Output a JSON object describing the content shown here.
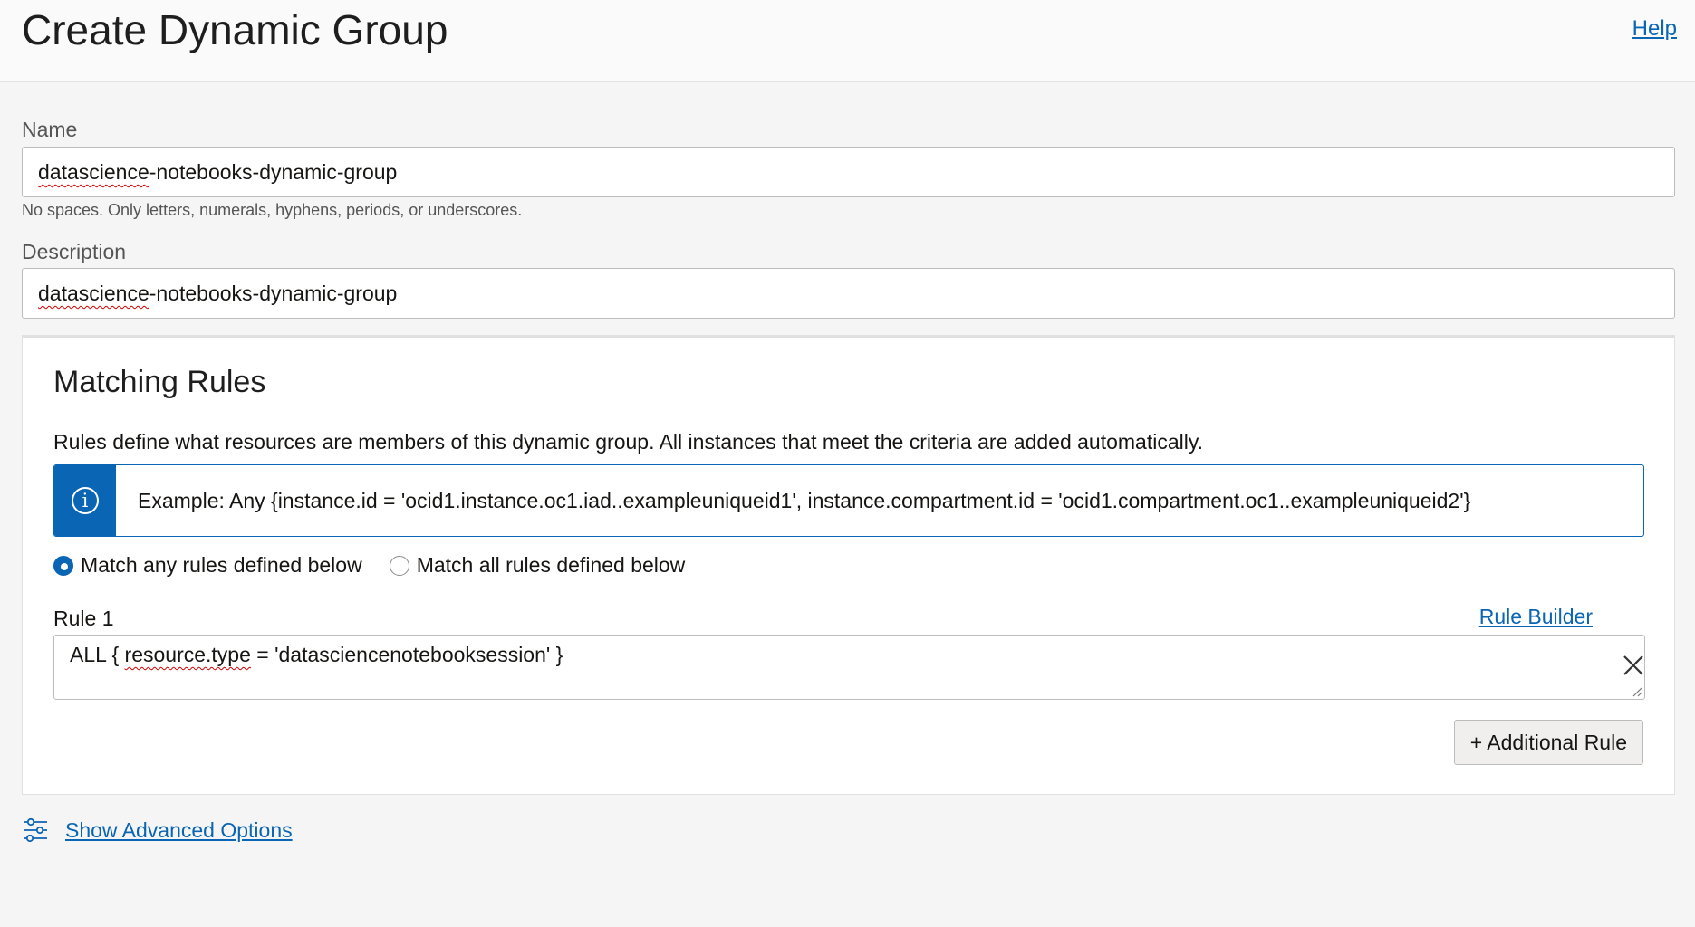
{
  "header": {
    "title": "Create Dynamic Group",
    "help_label": "Help"
  },
  "form": {
    "name": {
      "label": "Name",
      "value_prefix": "datascience",
      "value_rest": "-notebooks-dynamic-group",
      "hint": "No spaces. Only letters, numerals, hyphens, periods, or underscores."
    },
    "description": {
      "label": "Description",
      "value_prefix": "datascience",
      "value_rest": "-notebooks-dynamic-group"
    }
  },
  "matching_rules": {
    "title": "Matching Rules",
    "description": "Rules define what resources are members of this dynamic group. All instances that meet the criteria are added automatically.",
    "info_icon": "info-circle-icon",
    "example": "Example: Any {instance.id = 'ocid1.instance.oc1.iad..exampleuniqueid1', instance.compartment.id = 'ocid1.compartment.oc1..exampleuniqueid2'}",
    "match_options": [
      {
        "label": "Match any rules defined below",
        "selected": true
      },
      {
        "label": "Match all rules defined below",
        "selected": false
      }
    ],
    "rules": [
      {
        "label": "Rule 1",
        "builder_label": "Rule Builder",
        "value_before": "ALL { ",
        "value_misspelled": "resource.type",
        "value_after": " = 'datasciencenotebooksession' }",
        "remove_icon": "close-icon"
      }
    ],
    "add_rule_label": "+ Additional Rule"
  },
  "advanced": {
    "icon": "sliders-icon",
    "label": "Show Advanced Options"
  },
  "colors": {
    "accent": "#0a65b4",
    "background": "#f5f5f5",
    "panel": "#ffffff"
  }
}
